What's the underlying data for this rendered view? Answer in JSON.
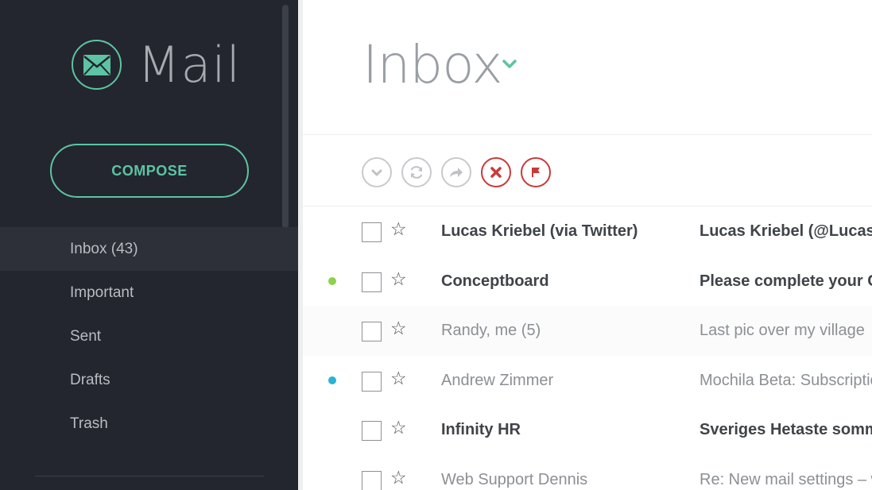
{
  "app": {
    "logo_text": "Mail",
    "compose_label": "COMPOSE",
    "accent_color": "#5cc4a4"
  },
  "sidebar": {
    "items": [
      {
        "label": "Inbox (43)",
        "active": true
      },
      {
        "label": "Important",
        "active": false
      },
      {
        "label": "Sent",
        "active": false
      },
      {
        "label": "Drafts",
        "active": false
      },
      {
        "label": "Trash",
        "active": false
      }
    ]
  },
  "main": {
    "title": "Inbox",
    "toolbar": [
      {
        "icon": "check-icon"
      },
      {
        "icon": "refresh-icon"
      },
      {
        "icon": "forward-icon"
      },
      {
        "icon": "delete-icon"
      },
      {
        "icon": "flag-icon"
      }
    ]
  },
  "emails": [
    {
      "sender": "Lucas Kriebel (via Twitter)",
      "subject": "Lucas Kriebel (@LucasKriebel) has sent you a direct message",
      "unread": true,
      "dot": ""
    },
    {
      "sender": "Conceptboard",
      "subject": "Please complete your Conceptboard signup",
      "unread": true,
      "dot": "#8cd24b"
    },
    {
      "sender": "Randy, me (5)",
      "subject": "Last pic over my village",
      "unread": false,
      "dot": ""
    },
    {
      "sender": "Andrew Zimmer",
      "subject": "Mochila Beta: Subscription Confirmed",
      "unread": false,
      "dot": "#27b2d6"
    },
    {
      "sender": "Infinity HR",
      "subject": "Sveriges Hetaste sommarjobb",
      "unread": true,
      "dot": ""
    },
    {
      "sender": "Web Support Dennis",
      "subject": "Re: New mail settings – will take effect",
      "unread": false,
      "dot": ""
    }
  ]
}
